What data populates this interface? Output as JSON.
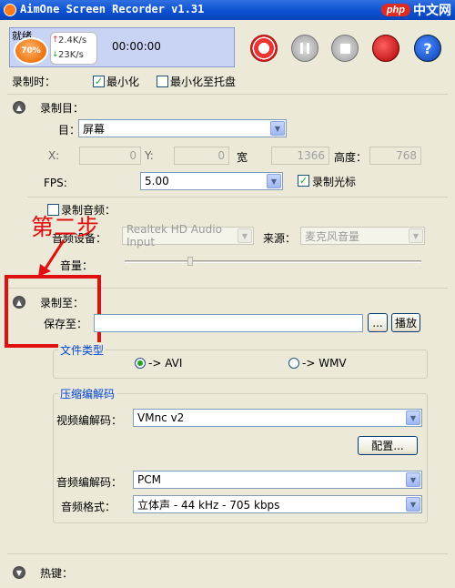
{
  "window": {
    "title": "AimOne Screen Recorder v1.31"
  },
  "watermark": {
    "brand": "php",
    "site": "中文网"
  },
  "toolbar": {
    "status_label": "就绪",
    "badge_text": "70%",
    "upload_speed": "2.4K/s",
    "download_speed": "23K/s",
    "elapsed_time": "00:00:00"
  },
  "recording_options": {
    "label": "录制时：",
    "minimize_label": "最小化",
    "minimize_checked": true,
    "minimize_tray_label": "最小化至托盘",
    "minimize_tray_checked": false
  },
  "record_target": {
    "section_title": "录制目：",
    "target_label": "目：",
    "target_value": "屏幕",
    "x_label": "X:",
    "x_value": "0",
    "y_label": "Y:",
    "y_value": "0",
    "width_label": "宽",
    "width_value": "1366",
    "height_label": "高度：",
    "height_value": "768",
    "fps_label": "FPS:",
    "fps_value": "5.00",
    "cursor_label": "录制光标",
    "cursor_checked": true
  },
  "audio": {
    "record_audio_label": "录制音频：",
    "record_audio_checked": false,
    "device_label": "音频设备：",
    "device_value": "Realtek HD Audio Input",
    "source_label": "来源：",
    "source_value": "麦克风音量",
    "volume_label": "音量：",
    "volume_level": 0.22
  },
  "annotation": {
    "text": "第二步"
  },
  "record_to": {
    "section_title": "录制至：",
    "save_label": "保存至：",
    "save_value": "",
    "browse_label": "...",
    "play_label": "播放"
  },
  "file_type": {
    "group_title": "文件类型",
    "avi_label": "-> AVI",
    "avi_selected": true,
    "wmv_label": "-> WMV",
    "wmv_selected": false
  },
  "codec": {
    "group_title": "压缩编解码",
    "video_codec_label": "视频编解码：",
    "video_codec_value": "VMnc v2",
    "config_label": "配置...",
    "audio_codec_label": "音频编解码：",
    "audio_codec_value": "PCM",
    "audio_format_label": "音频格式：",
    "audio_format_value": "立体声 - 44 kHz - 705 kbps"
  },
  "hotkeys": {
    "section_title": "热键："
  },
  "colors": {
    "accent": "#0046d5",
    "annotation": "#e01010",
    "titlebar": "#0b4fd0"
  }
}
